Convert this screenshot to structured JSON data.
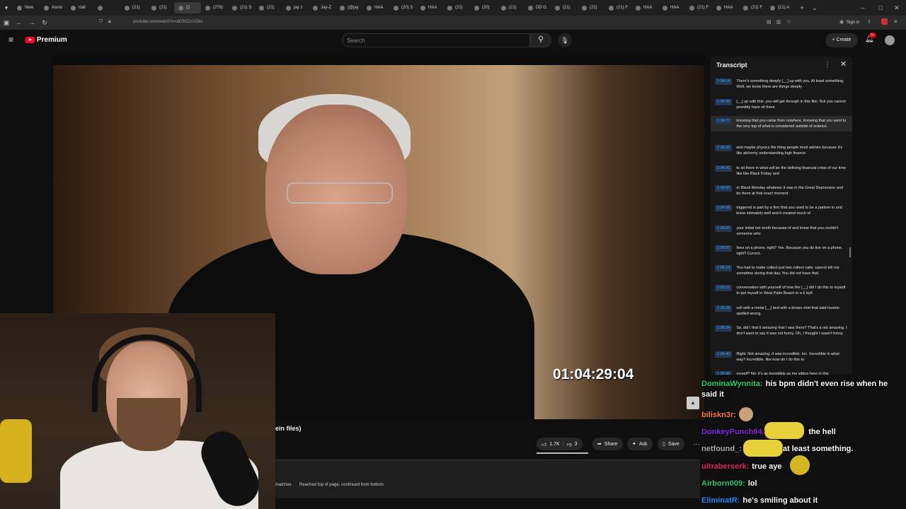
{
  "browser": {
    "tabs": [
      {
        "label": "New"
      },
      {
        "label": "Asmo"
      },
      {
        "label": "r/all"
      },
      {
        "label": ""
      },
      {
        "label": "(21)"
      },
      {
        "label": "(21)"
      },
      {
        "label": "(2"
      },
      {
        "label": "(278)"
      },
      {
        "label": "(21) S"
      },
      {
        "label": "(21)"
      },
      {
        "label": "jay z"
      },
      {
        "label": "Jay-Z"
      },
      {
        "label": "(@jay"
      },
      {
        "label": "HAA"
      },
      {
        "label": "(20) S"
      },
      {
        "label": "HAA"
      },
      {
        "label": "(21)"
      },
      {
        "label": "(20)"
      },
      {
        "label": "(21)"
      },
      {
        "label": "DD G"
      },
      {
        "label": "(21)"
      },
      {
        "label": "(21)"
      },
      {
        "label": "(21) F"
      },
      {
        "label": "HAA"
      },
      {
        "label": "HAA"
      },
      {
        "label": "(21) F"
      },
      {
        "label": "HAA"
      },
      {
        "label": "(21) F"
      },
      {
        "label": "(21) A"
      }
    ],
    "url": "youtube.com/watch?v=dOSIZzcV2ks",
    "sign_in": "Sign in"
  },
  "youtube": {
    "logo": "Premium",
    "search_placeholder": "Search",
    "create": "Create",
    "notif_badge": "9+",
    "video": {
      "timecode": "01:04:29:04",
      "title_fragment": "ein files)"
    },
    "actions": {
      "likes": "1.7K",
      "dislikes": "3",
      "share": "Share",
      "ask": "Ask",
      "save": "Save"
    },
    "findbar": {
      "matches": "matches",
      "message": "Reached top of page, continued from bottom"
    }
  },
  "transcript": {
    "title": "Transcript",
    "segments": [
      {
        "time": "1:04:14",
        "text": "There's something deeply [__] up with you. At least something. Well, we know there are things deeply"
      },
      {
        "time": "1:04:20",
        "text": "[__] up with this. you will get through in this film. But you cannot possibly have sit there"
      },
      {
        "time": "1:04:27",
        "text": "knowing that you came from nowhere, knowing that you went to the very top of what is considered outside of science"
      },
      {
        "time": "1:04:33",
        "text": "and maybe physics the thing people most admire because it's like alchemy understanding high finance"
      },
      {
        "time": "1:04:41",
        "text": "to sit there in what will be the defining financial crisis of our time like like Black Friday and"
      },
      {
        "time": "1:04:50",
        "text": "or Black Monday whatever it was in the Great Depression and be there at that exact moment"
      },
      {
        "time": "1:04:56",
        "text": "triggered in part by a firm that you used to be a partner in and knew intimately well and it created much of"
      },
      {
        "time": "1:05:02",
        "text": "your initial net worth because of and know that you couldn't someone who"
      },
      {
        "time": "1:05:07",
        "text": "lives on a phone, right? Yes. Because you do live on a phone, right? Correct."
      },
      {
        "time": "1:05:13",
        "text": "You had to make collect just two collect calls. cannot tell me sometime during that day. You did not have that"
      },
      {
        "time": "1:05:21",
        "text": "conversation with yourself of how the [__] did I do this to myself to put myself in West Palm Beach in a 6 by9"
      },
      {
        "time": "1:05:28",
        "text": "cell with a metal [__] bed with a brown shirt that said trustee spelled wrong."
      },
      {
        "time": "1:05:34",
        "text": "So, did I find it amazing that I was there? That's a not amazing. I don't want to say it was not funny. Oh, I thought I wasn't funny."
      },
      {
        "time": "1:05:40",
        "text": "Right. Not amazing. It was incredible. Inc. Incredible in what way? Incredible. like how do I do this to"
      },
      {
        "time": "1:05:46",
        "text": "myself? No, it's as incredible as me sitting here in this"
      }
    ]
  },
  "chat": {
    "messages": [
      {
        "user": "DominaWynnita:",
        "text": "his bpm didn't even rise when he said it",
        "color": "#2ecc71"
      },
      {
        "user": "biliskn3r:",
        "text": "",
        "color": "#ff7f50"
      },
      {
        "user": "DonkeyPunch64:",
        "text": "the hell",
        "color": "#8a2be2"
      },
      {
        "user": "netfound_:",
        "text": "at least something.",
        "color": "#b0b0b0"
      },
      {
        "user": "ultraberserk:",
        "text": "true aye",
        "color": "#e0245e"
      },
      {
        "user": "Airborn009:",
        "text": "lol",
        "color": "#2ecc71"
      },
      {
        "user": "EliminatR:",
        "text": "he's smiling about it",
        "color": "#1e90ff"
      }
    ]
  }
}
